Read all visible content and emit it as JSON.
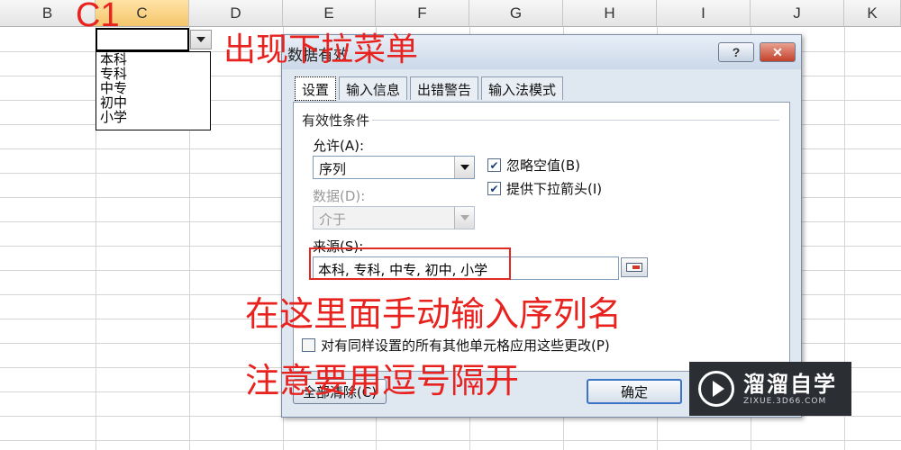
{
  "sheet": {
    "columns": [
      "B",
      "C",
      "D",
      "E",
      "F",
      "G",
      "H",
      "I",
      "J",
      "K"
    ],
    "selected_column": "C",
    "dropdown_items": [
      "本科",
      "专科",
      "中专",
      "初中",
      "小学"
    ]
  },
  "annotations": {
    "c1": "C1",
    "dropdown": "出现下拉菜单",
    "input_hint": "在这里面手动输入序列名",
    "comma_hint": "注意要用逗号隔开"
  },
  "dialog": {
    "title": "数据有效",
    "help_label": "?",
    "close_label": "✕",
    "tabs": [
      {
        "label": "设置",
        "active": true
      },
      {
        "label": "输入信息",
        "active": false
      },
      {
        "label": "出错警告",
        "active": false
      },
      {
        "label": "输入法模式",
        "active": false
      }
    ],
    "group_label": "有效性条件",
    "allow_label": "允许(A):",
    "allow_value": "序列",
    "data_label": "数据(D):",
    "data_value": "介于",
    "ignore_blank_label": "忽略空值(B)",
    "ignore_blank_checked": true,
    "dropdown_arrow_label": "提供下拉箭头(I)",
    "dropdown_arrow_checked": true,
    "source_label": "来源(S):",
    "source_value": "本科, 专科, 中专, 初中, 小学",
    "apply_all_label": "对有同样设置的所有其他单元格应用这些更改(P)",
    "apply_all_checked": false,
    "clear_all_label": "全部清除(C)",
    "ok_label": "确定"
  },
  "watermark": {
    "name": "溜溜自学",
    "url": "ZIXUE.3D66.COM"
  },
  "colors": {
    "annotation": "#e8221e",
    "dialog_bg": "#dfe7f1",
    "selected_column_header": "#f5c66a"
  }
}
